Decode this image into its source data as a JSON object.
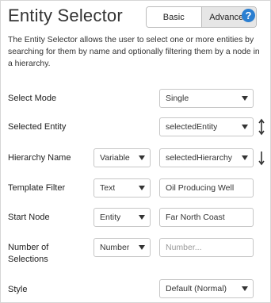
{
  "title": "Entity Selector",
  "modes": {
    "basic": "Basic",
    "advanced": "Advanced",
    "active": "Advanced"
  },
  "description": "The Entity Selector allows the user to select one or more entities by searching for them by name and optionally filtering them by a node in a hierarchy.",
  "fields": {
    "select_mode": {
      "label": "Select Mode",
      "value": "Single"
    },
    "selected_entity": {
      "label": "Selected Entity",
      "value": "selectedEntity"
    },
    "hierarchy_name": {
      "label": "Hierarchy Name",
      "type": "Variable",
      "value": "selectedHierarchy"
    },
    "template_filter": {
      "label": "Template Filter",
      "type": "Text",
      "value": "Oil Producing Well"
    },
    "start_node": {
      "label": "Start Node",
      "type": "Entity",
      "value": "Far North Coast"
    },
    "number_of_selections": {
      "label": "Number of Selections",
      "type": "Number",
      "placeholder": "Number..."
    },
    "style": {
      "label": "Style",
      "value": "Default (Normal)"
    }
  },
  "icons": {
    "help": "help-circle-icon",
    "two_way": "two-way-binding-icon",
    "one_way": "one-way-binding-icon"
  },
  "colors": {
    "accent": "#2b7fd1",
    "border": "#c6c6c6"
  }
}
